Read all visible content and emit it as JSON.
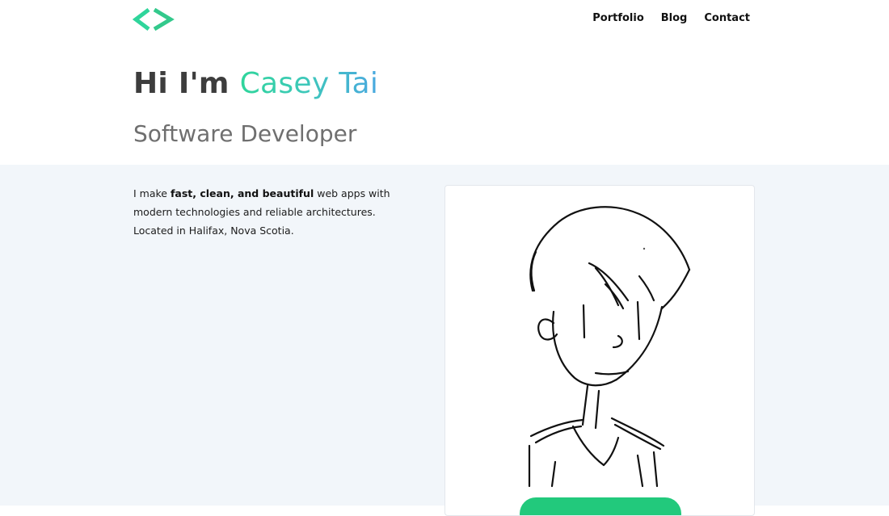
{
  "logo": {
    "icon": "code-brackets-icon",
    "color": "#2fd59b"
  },
  "nav": {
    "items": [
      {
        "label": "Portfolio"
      },
      {
        "label": "Blog"
      },
      {
        "label": "Contact"
      }
    ]
  },
  "hero": {
    "greeting": "Hi I'm ",
    "name": "Casey Tai",
    "subtitle": "Software Developer",
    "name_gradient": [
      "#2fd59b",
      "#4aa8e0"
    ]
  },
  "intro": {
    "prefix": "I make ",
    "emphasis": "fast, clean, and beautiful",
    "line_rest": " web apps with modern technologies and reliable architectures.",
    "location": "Located in Halifax, Nova Scotia."
  },
  "card": {
    "illustration": "self-portrait-sketch",
    "cta_label": "",
    "cta_color": "#22c97c"
  },
  "colors": {
    "content_bg": "#f2f6fa",
    "heading": "#3d3d3d",
    "subtitle": "#6f6f6f"
  }
}
